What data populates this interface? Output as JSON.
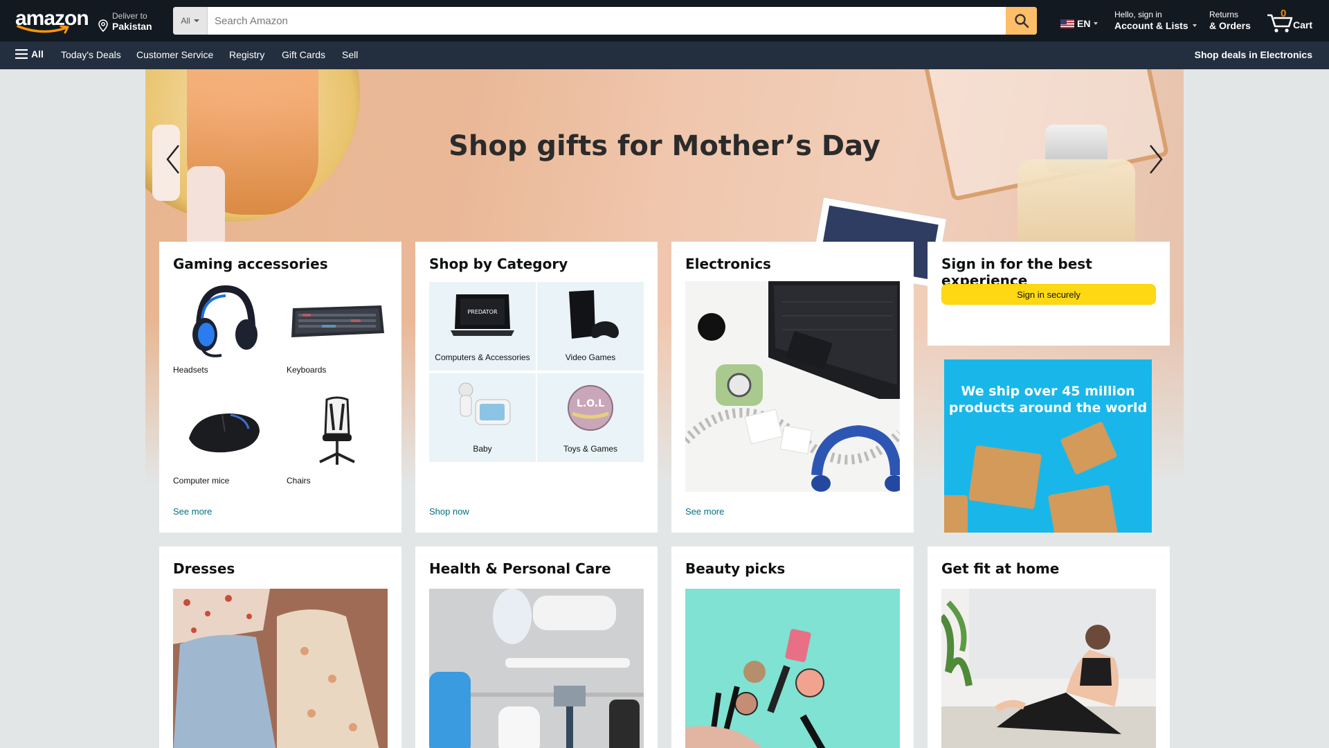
{
  "header": {
    "logo_text": "amazon",
    "deliver_line1": "Deliver to",
    "deliver_line2": "Pakistan",
    "search_category": "All",
    "search_placeholder": "Search Amazon",
    "language": "EN",
    "account_line1": "Hello, sign in",
    "account_line2": "Account & Lists",
    "returns_line1": "Returns",
    "returns_line2": "& Orders",
    "cart_count": "0",
    "cart_label": "Cart"
  },
  "subnav": {
    "all_label": "All",
    "links": [
      "Today's Deals",
      "Customer Service",
      "Registry",
      "Gift Cards",
      "Sell"
    ],
    "promo": "Shop deals in Electronics"
  },
  "hero": {
    "headline": "Shop gifts for Mother’s Day"
  },
  "cards": {
    "gaming": {
      "title": "Gaming accessories",
      "items": [
        "Headsets",
        "Keyboards",
        "Computer mice",
        "Chairs"
      ],
      "link": "See more"
    },
    "category": {
      "title": "Shop by Category",
      "items": [
        "Computers & Accessories",
        "Video Games",
        "Baby",
        "Toys & Games"
      ],
      "link": "Shop now"
    },
    "electronics": {
      "title": "Electronics",
      "link": "See more"
    },
    "signin": {
      "title": "Sign in for the best experience",
      "button": "Sign in securely"
    },
    "ship_ad": {
      "text": "We ship over 45 million products around the world"
    },
    "row2": [
      {
        "title": "Dresses"
      },
      {
        "title": "Health & Personal Care"
      },
      {
        "title": "Beauty picks"
      },
      {
        "title": "Get fit at home"
      }
    ]
  },
  "colors": {
    "nav_dark": "#131921",
    "nav_sub": "#232f3e",
    "search_button": "#febd69",
    "signin_button": "#ffd814",
    "link": "#007185",
    "cart_count": "#f08804"
  }
}
